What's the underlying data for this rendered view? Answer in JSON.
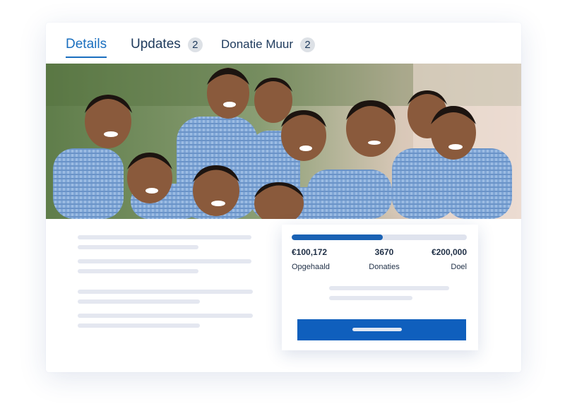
{
  "tabs": {
    "details": {
      "label": "Details"
    },
    "updates": {
      "label": "Updates",
      "count": "2"
    },
    "donation_wall": {
      "label": "Donatie Muur",
      "count": "2"
    }
  },
  "hero": {
    "description": "Photo of smiling schoolchildren in blue checked uniforms"
  },
  "stats": {
    "progress_fraction": 0.52,
    "raised": {
      "value": "€100,172",
      "label": "Opgehaald"
    },
    "donations": {
      "value": "3670",
      "label": "Donaties"
    },
    "goal": {
      "value": "€200,000",
      "label": "Doel"
    }
  },
  "colors": {
    "accent": "#1a6fbf",
    "button": "#0f5fbd",
    "text_dark": "#1e3a5c",
    "placeholder": "#e4e7f0"
  }
}
